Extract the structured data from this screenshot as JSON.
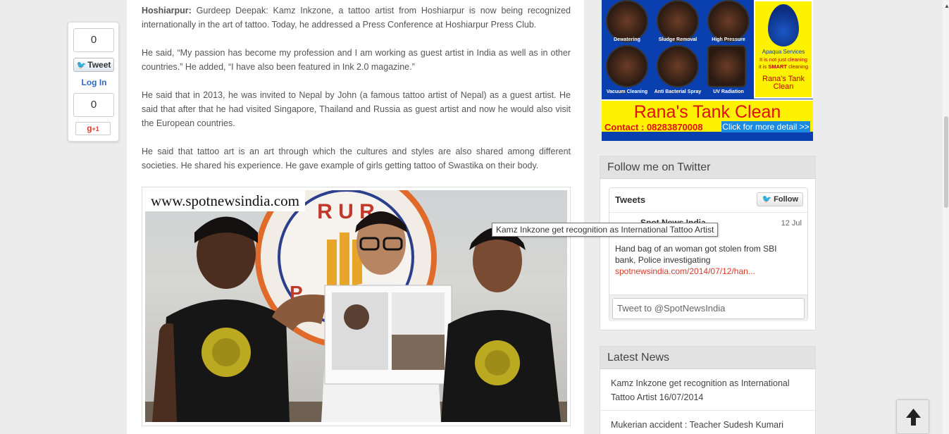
{
  "article": {
    "dateline": "Hoshiarpur:",
    "p1_text": " Gurdeep Deepak: Kamz Inkzone, a tattoo artist from Hoshiarpur is now being recognized internationally in the art of tattoo. Today, he addressed a Press Conference at Hoshiarpur Press Club.",
    "p2": "He said, “My passion has become my profession and I am working as guest artist in India as well as in other countries.” He added, “I have also been featured in Ink 2.0 magazine.”",
    "p3": "He said that in 2013, he was invited to Nepal by John (a famous tattoo artist of Nepal) as a guest artist. He said that after that he had visited Singapore, Thailand and Russia as guest artist and now he would also visit the European countries.",
    "p4": "He said that tattoo art is an art through which the cultures and styles are also shared among different societies. He shared his experience. He gave example of girls getting tattoo of Swastika on their body.",
    "photo_watermark": "www.spotnewsindia.com",
    "banner_letters": "R   U   R",
    "banner_letters_2": "P"
  },
  "share": {
    "tweet_count": "0",
    "tweet_label": "Tweet",
    "login_label": "Log In",
    "gplus_count": "0",
    "gplus_label": "g",
    "gplus_suffix": "+1"
  },
  "tooltip": "Kamz Inkzone get recognition as International Tattoo Artist",
  "ad": {
    "services": [
      "Dewatering",
      "Sludge Removal",
      "High Pressure",
      "Vacuum Cleaning",
      "Anti Bacterial Spray",
      "UV Radiation"
    ],
    "company": "Apaqua Services",
    "tagline_1": "It is not just cleaning",
    "tagline_2a": "it is ",
    "tagline_2b": "SMART",
    "tagline_2c": " cleaning",
    "brand_small_1": "Rana's Tank",
    "brand_small_2": "Clean",
    "title": "Rana's Tank Clean",
    "contact": "Contact : 08283870008",
    "cta": "Click for more detail >>"
  },
  "twitter_widget": {
    "heading": "Follow me on Twitter",
    "tweets_label": "Tweets",
    "follow_label": "Follow",
    "author": "Spot News India",
    "date": "12 Jul",
    "text": "Hand bag of an woman got stolen from SBI bank, Police investigating",
    "link": "spotnewsindia.com/2014/07/12/han...",
    "input_placeholder": "Tweet to @SpotNewsIndia"
  },
  "latest_news": {
    "heading": "Latest News",
    "items": [
      "Kamz Inkzone get recognition as International Tattoo Artist 16/07/2014",
      "Mukerian accident : Teacher Sudesh Kumari"
    ]
  },
  "back_to_top_icon": "arrow-up-icon",
  "colors": {
    "page_bg": "#ececec",
    "link_blue": "#3366cc",
    "twitter_blue": "#2ba9e1",
    "tweet_link_red": "#d83a2b",
    "ad_blue": "#0a3fb0",
    "ad_yellow": "#fff200",
    "ad_red": "#e01010"
  }
}
